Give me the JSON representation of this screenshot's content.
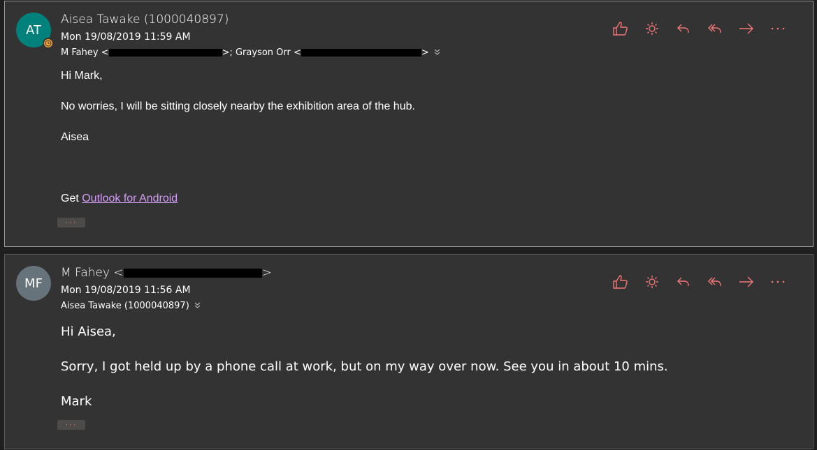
{
  "accent_color": "#f07878",
  "link_color": "#d39bf5",
  "actions": [
    "like-icon",
    "sun-icon",
    "reply-icon",
    "reply-all-icon",
    "forward-icon",
    "more-icon"
  ],
  "messages": [
    {
      "avatar_initials": "AT",
      "avatar_color": "#00817b",
      "sender": "Aisea Tawake (1000040897)",
      "date": "Mon 19/08/2019 11:59 AM",
      "recipients_prefix": "M Fahey <",
      "recipients_mid": ">; Grayson Orr <",
      "recipients_end": ">",
      "body": {
        "greeting": "Hi Mark,",
        "line1": "No worries, I will be sitting closely nearby the exhibition area of the hub.",
        "signoff": "Aisea",
        "get_text": "Get ",
        "link_text": "Outlook for Android"
      },
      "more_label": "···"
    },
    {
      "avatar_initials": "MF",
      "avatar_color": "#66737a",
      "sender_prefix": "M Fahey <",
      "sender_end": ">",
      "date": "Mon 19/08/2019 11:56 AM",
      "recipients": "Aisea Tawake (1000040897)",
      "body": {
        "greeting": "Hi Aisea,",
        "line1": "Sorry, I got held up by a phone call at work, but on my way over now.  See you in about 10 mins.",
        "signoff": "Mark"
      },
      "more_label": "···"
    }
  ]
}
